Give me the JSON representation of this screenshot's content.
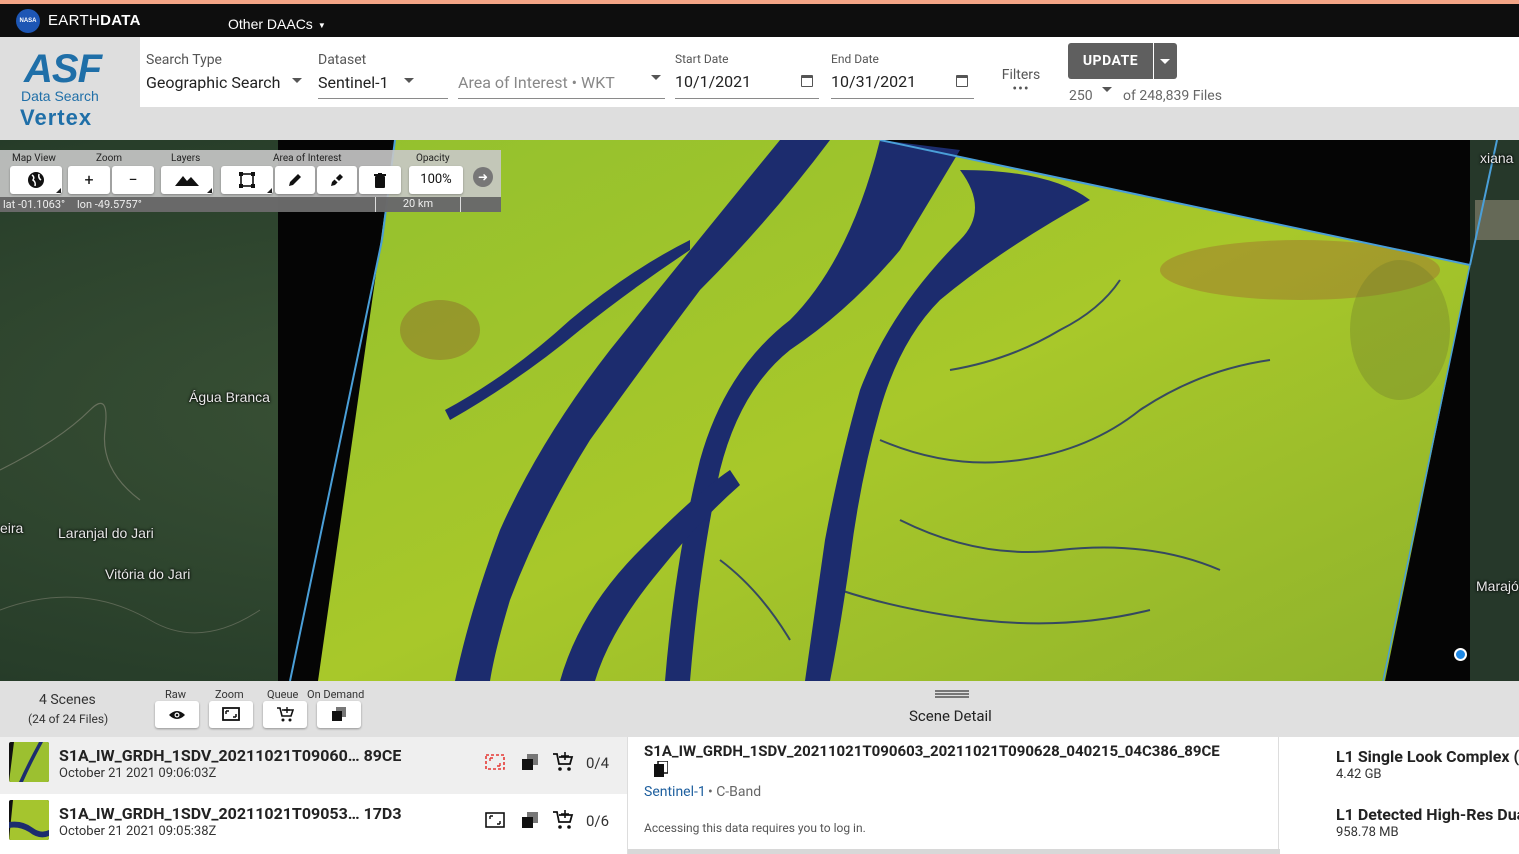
{
  "earthdata": {
    "nasa_badge": "NASA",
    "title_plain": "EARTH",
    "title_bold": "DATA",
    "daacs_label": "Other DAACs"
  },
  "logo": {
    "asf": "ASF",
    "data_search": "Data Search",
    "vertex": "Vertex"
  },
  "search": {
    "search_type_label": "Search Type",
    "search_type_value": "Geographic Search",
    "dataset_label": "Dataset",
    "dataset_value": "Sentinel-1",
    "aoi_placeholder": "Area of Interest • WKT",
    "start_label": "Start Date",
    "start_value": "10/1/2021",
    "end_label": "End Date",
    "end_value": "10/31/2021",
    "filters_label": "Filters",
    "filters_dots": "•••",
    "update_label": "UPDATE",
    "max_results": "250",
    "files_label": "of 248,839 Files"
  },
  "map_toolbar": {
    "map_view_label": "Map View",
    "zoom_label": "Zoom",
    "layers_label": "Layers",
    "aoi_label": "Area of Interest",
    "opacity_label": "Opacity",
    "zoom_in": "+",
    "zoom_out": "−",
    "opacity_value": "100%",
    "lat": "lat -01.1063°",
    "lon": "lon -49.5757°",
    "scale": "20 km"
  },
  "map_places": {
    "agua_branca": "Água Branca",
    "laranjal": "Laranjal do Jari",
    "vitoria": "Vitória do Jari",
    "eira": "eira",
    "xiana": "xiana",
    "marajo": "Marajó"
  },
  "scenes": {
    "count_label": "4 Scenes",
    "files_label": "(24 of 24 Files)",
    "raw_label": "Raw",
    "zoom_label": "Zoom",
    "queue_label": "Queue",
    "ondemand_label": "On Demand",
    "rows": [
      {
        "name": "S1A_IW_GRDH_1SDV_20211021T09060… 89CE",
        "date": "October 21 2021 09:06:03Z",
        "count": "0/4"
      },
      {
        "name": "S1A_IW_GRDH_1SDV_20211021T09053… 17D3",
        "date": "October 21 2021 09:05:38Z",
        "count": "0/6"
      }
    ]
  },
  "detail": {
    "header": "Scene Detail",
    "name": "S1A_IW_GRDH_1SDV_20211021T090603_20211021T090628_040215_04C386_89CE",
    "platform": "Sentinel-1",
    "band": "• C-Band",
    "note": "Accessing this data requires you to log in."
  },
  "files": [
    {
      "name": "L1 Single Look Complex (",
      "size": "4.42 GB"
    },
    {
      "name": "L1 Detected High-Res Dua",
      "size": "958.78 MB"
    }
  ],
  "colors": {
    "accent_blue": "#1f6fa8",
    "footprint_blue": "#4a9fd8",
    "update_button": "#5f5f5f",
    "selected_icon_red": "#e53935"
  }
}
